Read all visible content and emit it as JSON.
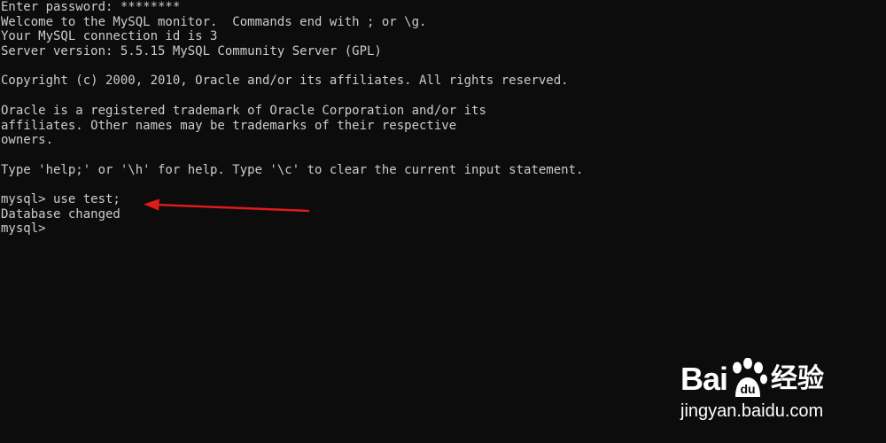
{
  "terminal": {
    "lines": [
      "Enter password: ********",
      "Welcome to the MySQL monitor.  Commands end with ; or \\g.",
      "Your MySQL connection id is 3",
      "Server version: 5.5.15 MySQL Community Server (GPL)",
      "",
      "Copyright (c) 2000, 2010, Oracle and/or its affiliates. All rights reserved.",
      "",
      "Oracle is a registered trademark of Oracle Corporation and/or its",
      "affiliates. Other names may be trademarks of their respective",
      "owners.",
      "",
      "Type 'help;' or '\\h' for help. Type '\\c' to clear the current input statement.",
      "",
      "mysql> use test;",
      "Database changed",
      "mysql>"
    ]
  },
  "colors": {
    "background": "#0c0c0c",
    "text": "#cccccc",
    "annotation": "#e01a1a",
    "watermark": "#ffffff"
  },
  "watermark": {
    "logo_text": "Bai",
    "logo_suffix": "经验",
    "url": "jingyan.baidu.com"
  }
}
